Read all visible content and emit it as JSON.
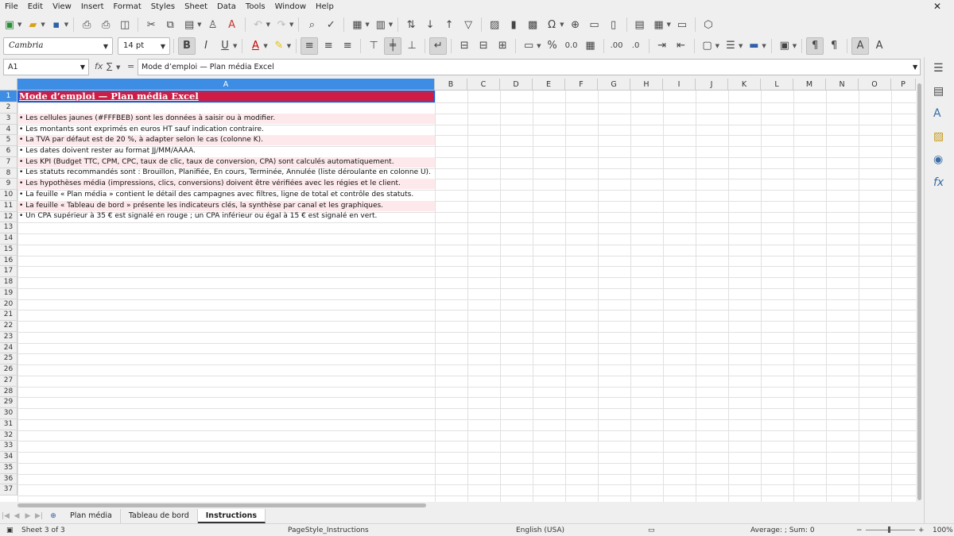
{
  "menu": [
    "File",
    "Edit",
    "View",
    "Insert",
    "Format",
    "Styles",
    "Sheet",
    "Data",
    "Tools",
    "Window",
    "Help"
  ],
  "font": {
    "name": "Cambria",
    "size": "14 pt"
  },
  "namebox": "A1",
  "formula": "Mode d’emploi — Plan média Excel",
  "columns": [
    "A",
    "B",
    "C",
    "D",
    "E",
    "F",
    "G",
    "H",
    "I",
    "J",
    "K",
    "L",
    "M",
    "N",
    "O",
    "P"
  ],
  "rows": [
    "1",
    "2",
    "3",
    "4",
    "5",
    "6",
    "7",
    "8",
    "9",
    "10",
    "11",
    "12",
    "13",
    "14",
    "15",
    "16",
    "17",
    "18",
    "19",
    "20",
    "21",
    "22",
    "23",
    "24",
    "25",
    "26",
    "27",
    "28",
    "29",
    "30",
    "31",
    "32",
    "33",
    "34",
    "35",
    "36",
    "37"
  ],
  "cells": {
    "a1": "Mode d’emploi — Plan média Excel",
    "a3": "• Les cellules jaunes (#FFFBEB) sont les données à saisir ou à modifier.",
    "a4": "• Les montants sont exprimés en euros HT sauf indication contraire.",
    "a5": "• La TVA par défaut est de 20 %, à adapter selon le cas (colonne K).",
    "a6": "• Les dates doivent rester au format JJ/MM/AAAA.",
    "a7": "• Les KPI (Budget TTC, CPM, CPC, taux de clic, taux de conversion, CPA) sont calculés automatiquement.",
    "a8": "• Les statuts recommandés sont : Brouillon, Planifiée, En cours, Terminée, Annulée (liste déroulante en colonne U).",
    "a9": "• Les hypothèses média (impressions, clics, conversions) doivent être vérifiées avec les régies et le client.",
    "a10": "• La feuille « Plan média » contient le détail des campagnes avec filtres, ligne de total et contrôle des statuts.",
    "a11": "• La feuille « Tableau de bord » présente les indicateurs clés, la synthèse par canal et les graphiques.",
    "a12": "• Un CPA supérieur à 35 € est signalé en rouge ; un CPA inférieur ou égal à 15 € est signalé en vert."
  },
  "tabs": [
    "Plan média",
    "Tableau de bord",
    "Instructions"
  ],
  "status": {
    "sheet": "Sheet 3 of 3",
    "pagestyle": "PageStyle_Instructions",
    "language": "English (USA)",
    "sum": "Average: ; Sum: 0",
    "zoom": "100%"
  },
  "colors": {
    "title_bg": "#d01c45",
    "row_tint": "#fde9ec",
    "selection": "#3d8de5"
  }
}
